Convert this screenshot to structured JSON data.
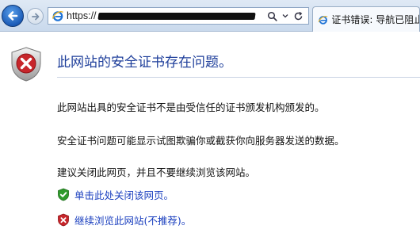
{
  "browser": {
    "address_prefix": "https://",
    "address_redacted": true,
    "address_actions": [
      "search-icon",
      "dropdown-icon",
      "refresh-icon"
    ],
    "tab": {
      "label": "证书错误: 导航已阻止",
      "icon": "ie-icon"
    }
  },
  "page": {
    "title": "此网站的安全证书存在问题。",
    "paragraphs": [
      "此网站出具的安全证书不是由受信任的证书颁发机构颁发的。",
      "安全证书问题可能显示试图欺骗你或截获你向服务器发送的数据。",
      "建议关闭此网页，并且不要继续浏览该网站。"
    ],
    "links": {
      "close": {
        "label": "单击此处关闭该网页。",
        "icon": "green-shield-check-icon"
      },
      "continue": {
        "label": "继续浏览此网站(不推荐)。",
        "icon": "red-shield-x-icon"
      }
    }
  },
  "colors": {
    "title": "#1f3f9b",
    "link": "#1a3fbf",
    "warning_red": "#c7262b",
    "safe_green": "#2f9a2c"
  }
}
